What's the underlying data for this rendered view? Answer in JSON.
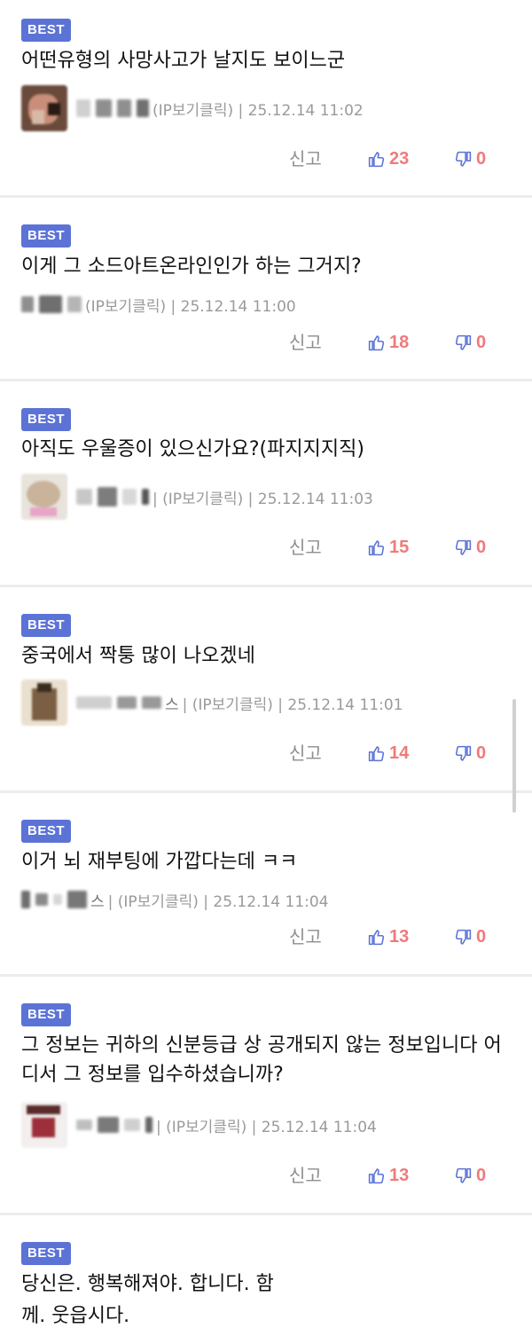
{
  "comments": [
    {
      "badge": "BEST",
      "text": "어떤유형의 사망사고가 날지도 보이느군",
      "name_suffix": "",
      "meta": "(IP보기클릭) | 25.12.14 11:02",
      "report": "신고",
      "likes": "23",
      "dislikes": "0"
    },
    {
      "badge": "BEST",
      "text": "이게 그 소드아트온라인인가 하는 그거지?",
      "name_suffix": "",
      "meta": "(IP보기클릭) | 25.12.14 11:00",
      "report": "신고",
      "likes": "18",
      "dislikes": "0"
    },
    {
      "badge": "BEST",
      "text": "아직도 우울증이 있으신가요?(파지지지직)",
      "name_suffix": "",
      "meta": "| (IP보기클릭) | 25.12.14 11:03",
      "report": "신고",
      "likes": "15",
      "dislikes": "0"
    },
    {
      "badge": "BEST",
      "text": "중국에서 짝퉁 많이 나오겠네",
      "name_suffix": "스",
      "meta": "| (IP보기클릭) | 25.12.14 11:01",
      "report": "신고",
      "likes": "14",
      "dislikes": "0"
    },
    {
      "badge": "BEST",
      "text": "이거 뇌 재부팅에 가깝다는데 ㅋㅋ",
      "name_suffix": "스",
      "meta": "| (IP보기클릭) | 25.12.14 11:04",
      "report": "신고",
      "likes": "13",
      "dislikes": "0"
    },
    {
      "badge": "BEST",
      "text": "그 정보는 귀하의 신분등급 상 공개되지 않는 정보입니다 어디서 그 정보를 입수하셨습니까?",
      "name_suffix": "",
      "meta": "| (IP보기클릭) | 25.12.14 11:04",
      "report": "신고",
      "likes": "13",
      "dislikes": "0"
    },
    {
      "badge": "BEST",
      "text": "당신은. 행복해져야. 합니다. 함께. 웃읍시다."
    }
  ],
  "colors": {
    "badge": "#5c73d6",
    "like": "#5c73d6",
    "count": "#f07a7a",
    "divider": "#ececf0"
  },
  "icons": {
    "like": "thumbs-up-icon",
    "dislike": "thumbs-down-icon"
  }
}
